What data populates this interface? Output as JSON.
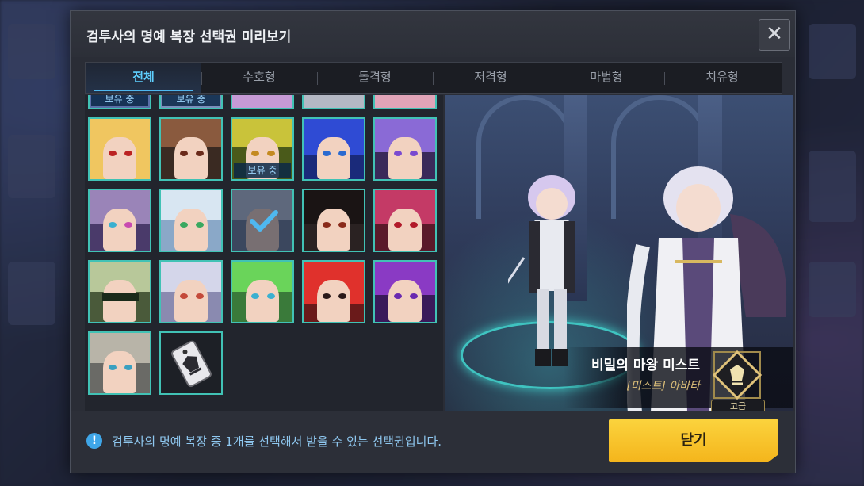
{
  "dialog": {
    "title": "검투사의 명예 복장 선택권 미리보기",
    "close_icon": "close-icon"
  },
  "tabs": [
    {
      "label": "전체",
      "active": true
    },
    {
      "label": "수호형",
      "active": false
    },
    {
      "label": "돌격형",
      "active": false
    },
    {
      "label": "저격형",
      "active": false
    },
    {
      "label": "마법형",
      "active": false
    },
    {
      "label": "치유형",
      "active": false
    }
  ],
  "owned_label": "보유 중",
  "preview": {
    "costume_name": "비밀의 마왕 미스트",
    "costume_type": "[미스트] 아바타",
    "grade": "고급"
  },
  "footer": {
    "notice": "검투사의 명예 복장 중 1개를 선택해서 받을 수 있는 선택권입니다.",
    "close_button": "닫기"
  },
  "colors": {
    "accent": "#4fb8f0",
    "slot_border": "#41c2b5",
    "button": "#f4b51c"
  }
}
